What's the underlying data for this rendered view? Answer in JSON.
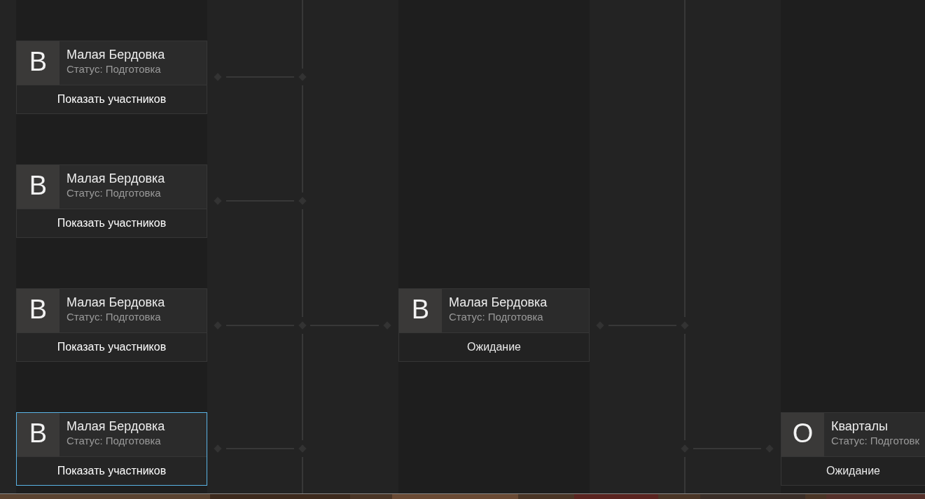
{
  "rounds": [
    {
      "cards": [
        {
          "letter": "В",
          "name": "Малая Бердовка",
          "status": "Статус: Подготовка",
          "footer": {
            "kind": "button",
            "label": "Показать участников"
          },
          "selected": false
        },
        {
          "letter": "В",
          "name": "Малая Бердовка",
          "status": "Статус: Подготовка",
          "footer": {
            "kind": "button",
            "label": "Показать участников"
          },
          "selected": false
        },
        {
          "letter": "В",
          "name": "Малая Бердовка",
          "status": "Статус: Подготовка",
          "footer": {
            "kind": "button",
            "label": "Показать участников"
          },
          "selected": false
        },
        {
          "letter": "В",
          "name": "Малая Бердовка",
          "status": "Статус: Подготовка",
          "footer": {
            "kind": "button",
            "label": "Показать участников"
          },
          "selected": true
        }
      ]
    },
    {
      "cards": [
        {
          "letter": "В",
          "name": "Малая Бердовка",
          "status": "Статус: Подготовка",
          "footer": {
            "kind": "status",
            "label": "Ожидание"
          },
          "selected": false
        }
      ]
    },
    {
      "cards": [
        {
          "letter": "О",
          "name": "Кварталы",
          "status": "Статус: Подготовк",
          "footer": {
            "kind": "status",
            "label": "Ожидание"
          },
          "selected": false
        }
      ]
    }
  ]
}
